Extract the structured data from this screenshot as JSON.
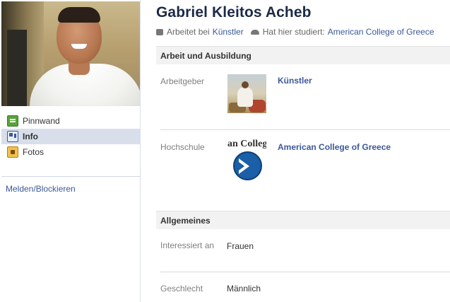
{
  "profile": {
    "name": "Gabriel Kleitos Acheb",
    "meta": {
      "work_prefix": "Arbeitet bei",
      "work_link": "Künstler",
      "study_prefix": "Hat hier studiert:",
      "study_link": "American College of Greece"
    }
  },
  "sidebar": {
    "items": [
      {
        "label": "Pinnwand",
        "icon": "wall-icon",
        "active": false
      },
      {
        "label": "Info",
        "icon": "info-icon",
        "active": true
      },
      {
        "label": "Fotos",
        "icon": "photos-icon",
        "active": false
      }
    ],
    "report_link": "Melden/Blockieren"
  },
  "work_education": {
    "header": "Arbeit und Ausbildung",
    "employer": {
      "label": "Arbeitgeber",
      "value": "Künstler",
      "thumb": "painting"
    },
    "college": {
      "label": "Hochschule",
      "value": "American College of Greece",
      "thumb_text": "an Colleg"
    }
  },
  "general": {
    "header": "Allgemeines",
    "interested_in": {
      "label": "Interessiert an",
      "value": "Frauen"
    },
    "gender": {
      "label": "Geschlecht",
      "value": "Männlich"
    }
  },
  "colors": {
    "link": "#3b5998",
    "name": "#1c2a47",
    "active_nav": "#d8dfea"
  }
}
